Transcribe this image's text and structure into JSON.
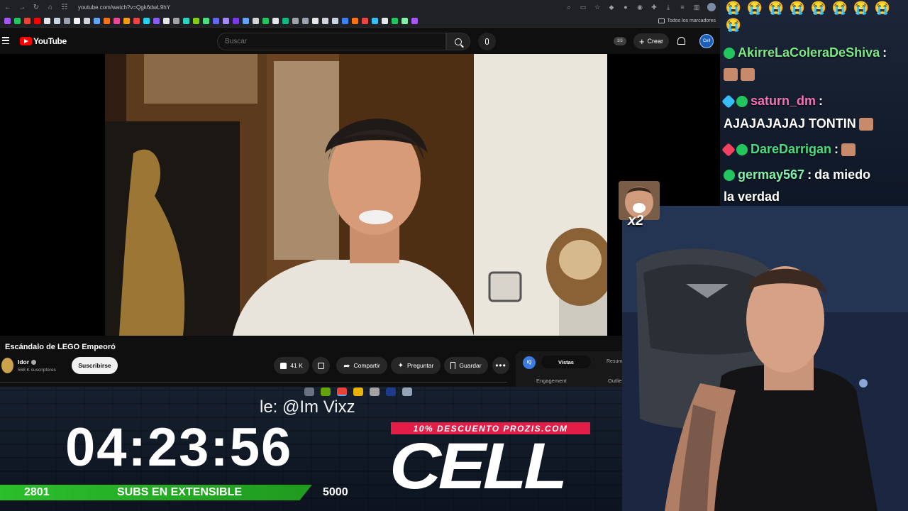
{
  "browser": {
    "url": "youtube.com/watch?v=Qgk6dwL9hY",
    "bookmarks_folder": "Todos los marcadores"
  },
  "youtube": {
    "logo": "YouTube",
    "search_placeholder": "Buscar",
    "ss_badge": "SS",
    "create_label": "Crear",
    "video_title": "Escándalo de LEGO Empeoró",
    "channel_name": "Idor",
    "channel_subs": "568 K suscriptores",
    "subscribe_label": "Suscribirse",
    "likes": "41 K",
    "share_label": "Compartir",
    "ask_label": "Preguntar",
    "save_label": "Guardar",
    "more_label": "•••",
    "ext_logo": "IQ",
    "ext_tab_active": "Vistas",
    "ext_tab_other": "Resum",
    "ext_engagement": "Engagement",
    "ext_outlier": "Outlie"
  },
  "overlay": {
    "ticker": "le: @Im Vixz",
    "timer": "04:23:56",
    "subs_current": "2801",
    "subs_label": "SUBS EN EXTENSIBLE",
    "subs_goal": "5000",
    "promo": "10% DESCUENTO PROZIS.COM",
    "brand": "CELL",
    "colors": {
      "promo": "#e11d48",
      "subs_bar": "#2bbf2b"
    }
  },
  "chat": {
    "top_emotes": [
      "😭",
      "😭",
      "😭",
      "😭",
      "😭",
      "😭",
      "😭",
      "😭",
      "😭"
    ],
    "messages": [
      {
        "user": "AkirreLaColeraDeShiva",
        "sep": ":",
        "text": ""
      },
      {
        "user": "saturn_dm",
        "sep": ":",
        "text": "AJAJAJAJAJ TONTIN"
      },
      {
        "user": "DareDarrigan",
        "sep": ":",
        "text": ""
      },
      {
        "user": "germay567",
        "sep": ":",
        "text": "da miedo",
        "text2": "la verdad"
      }
    ]
  },
  "reaction": {
    "multiplier": "x2"
  }
}
